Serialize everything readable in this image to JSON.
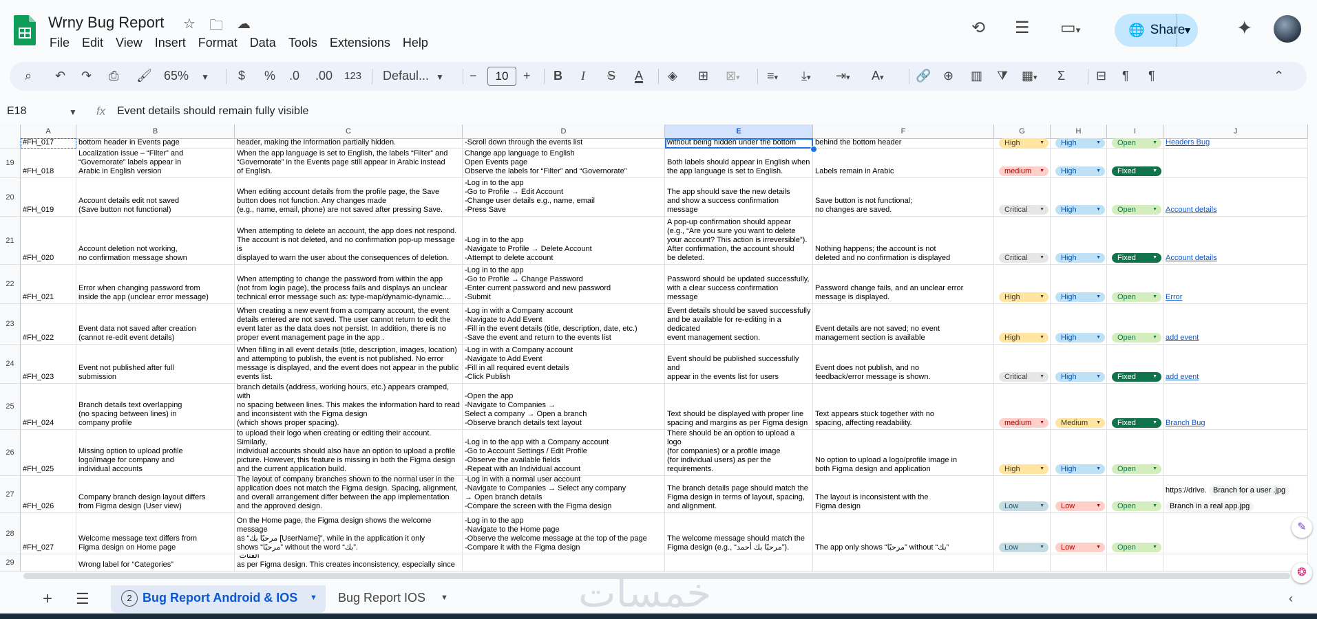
{
  "header": {
    "title": "Wrny Bug Report",
    "menu": [
      "File",
      "Edit",
      "View",
      "Insert",
      "Format",
      "Data",
      "Tools",
      "Extensions",
      "Help"
    ],
    "share_label": "Share",
    "colors": {
      "brand_green": "#0f9d58",
      "share_bg": "#c2e7ff"
    }
  },
  "toolbar": {
    "zoom": "65%",
    "currency": "$",
    "percent": "%",
    "dec_decrease": ".0",
    "dec_increase": ".00",
    "number_format": "123",
    "font": "Defaul...",
    "font_size": "10"
  },
  "formula": {
    "name_box": "E18",
    "fx": "fx",
    "content": "Event details should remain fully visible"
  },
  "columns": [
    "A",
    "B",
    "C",
    "D",
    "E",
    "F",
    "G",
    "H",
    "I",
    "J"
  ],
  "rows": [
    {
      "num": "",
      "id": "#FH_017",
      "title": "bottom header in Events page",
      "desc": "header, making the information partially hidden.",
      "steps": "-Scroll down through the events list",
      "expected": "without being hidden under the bottom head",
      "actual": "behind the bottom header",
      "severity": "High",
      "priority": "High",
      "status": "Open",
      "link": "Headers Bug",
      "extra": []
    },
    {
      "num": "19",
      "id": "#FH_018",
      "title": "Localization issue – “Filter” and\n“Governorate” labels appear in\n Arabic in English version",
      "desc": "When the app language is set to English, the labels “Filter” and\n“Governorate” in the Events page still appear in Arabic instead\nof English.",
      "steps": "Change app language to English\nOpen Events page\nObserve the labels for “Filter” and “Governorate”",
      "expected": "Both labels should appear in English when\n the app language is set to English.",
      "actual": "Labels remain in Arabic",
      "severity": "medium",
      "priority": "High",
      "status": "Fixed",
      "link": "",
      "extra": []
    },
    {
      "num": "20",
      "id": "#FH_019",
      "title": "Account details edit not saved\n (Save button not functional)",
      "desc": "When editing account details from the profile page, the Save\n button does not function. Any changes made\n(e.g., name, email, phone) are not saved after pressing Save.",
      "steps": "-Log in to the app\n-Go to Profile → Edit Account\n-Change user details e.g., name, email\n-Press Save",
      "expected": "The app should save the new details\n and show a success confirmation message",
      "actual": "Save button is not functional;\nno changes are saved.",
      "severity": "Critical",
      "priority": "High",
      "status": "Open",
      "link": "Account details",
      "extra": []
    },
    {
      "num": "21",
      "id": "#FH_020",
      "title": "Account deletion not working,\nno confirmation message shown",
      "desc": "When attempting to delete an account, the app does not respond.\nThe account is not deleted, and no confirmation pop-up message is\n displayed to warn the user about the consequences of deletion.",
      "steps": "-Log in to the app\n-Navigate to Profile → Delete Account\n-Attempt to delete account",
      "expected": "A pop-up confirmation should appear\n (e.g., “Are you sure you want to delete\nyour account? This action is irreversible”).\n After confirmation, the account should\nbe deleted.",
      "actual": "Nothing happens; the account is not\ndeleted and no confirmation is displayed",
      "severity": "Critical",
      "priority": "High",
      "status": "Fixed",
      "link": "Account details",
      "extra": []
    },
    {
      "num": "22",
      "id": "#FH_021",
      "title": "Error when changing password from\ninside the app (unclear error message)",
      "desc": "When attempting to change the password from within the app\n (not from login page), the process fails and displays an unclear\ntechnical error message such as: type-map/dynamic-dynamic....",
      "steps": "-Log in to the app\n-Go to Profile → Change Password\n-Enter current password and new password\n-Submit",
      "expected": "Password should be updated successfully,\nwith a clear success confirmation message",
      "actual": "Password change fails, and an unclear  error\n message is displayed.",
      "severity": "High",
      "priority": "High",
      "status": "Open",
      "link": "Error",
      "extra": []
    },
    {
      "num": "23",
      "id": "#FH_022",
      "title": "Event data not saved after creation\n(cannot re-edit event details)",
      "desc": "When creating a new event from a company account, the event\ndetails entered are not saved. The user cannot return to edit the\n event later as the data does not persist. In addition, there is no\nproper event management page in the app .",
      "steps": "-Log in with a Company account\n-Navigate to Add Event\n-Fill in the event details (title, description, date, etc.)\n-Save the event and return to the events list",
      "expected": "Event details should be saved successfully\nand be available for re-editing in a dedicated\nevent management section.",
      "actual": "Event details are not saved; no event\nmanagement section is available",
      "severity": "High",
      "priority": "High",
      "status": "Open",
      "link": "add event",
      "extra": []
    },
    {
      "num": "24",
      "id": "#FH_023",
      "title": "Event not published after full\nsubmission",
      "desc": "When filling in all event details (title, description, images, location)\nand attempting to publish, the event is not published. No error\n message is displayed, and the event does not appear in the public\nevents list.",
      "steps": "-Log in with a Company account\n-Navigate to Add Event\n-Fill in all required event details\n-Click Publish",
      "expected": "Event should be published successfully and\nappear in the events list for users",
      "actual": "Event does not publish, and no\n feedback/error message is shown.",
      "severity": "Critical",
      "priority": "High",
      "status": "Fixed",
      "link": "add event",
      "extra": []
    },
    {
      "num": "25",
      "id": "#FH_024",
      "title": "Branch details text overlapping\n(no spacing between lines) in\ncompany profile",
      "desc": "When viewing a company profile and opening a branch, the text in th\n branch details (address, working hours, etc.) appears cramped, with\nno spacing between lines. This makes the information hard to read\n and inconsistent with the Figma design\n(which shows proper spacing).",
      "steps": "-Open the app\n-Navigate to Companies →\n Select a company → Open a branch\n-Observe branch details text layout",
      "expected": "Text should be displayed with proper line\nspacing and margins as per Figma design",
      "actual": "Text appears stuck together with no\n spacing, affecting readability.",
      "severity": "medium",
      "priority": "Medium",
      "status": "Fixed",
      "link": "Branch Bug",
      "extra": []
    },
    {
      "num": "26",
      "id": "#FH_025",
      "title": "Missing option to upload profile\n logo/image for company and\n individual accounts",
      "desc": "According to the requirements document, companies should be able\n to upload their logo when creating or editing their account. Similarly,\nindividual accounts should also have an option to upload a profile\n picture. However, this feature is missing in both the Figma design\nand the current application build.",
      "steps": "-Log in to the app with a Company account\n-Go to Account Settings / Edit Profile\n-Observe the available fields\n-Repeat with an Individual account",
      "expected": "There should be an option to upload a logo\n(for companies) or a profile image\n (for individual users) as per the\n requirements.",
      "actual": "No option to upload a logo/profile image in\n both Figma design and application",
      "severity": "High",
      "priority": "High",
      "status": "Open",
      "link": "",
      "extra": []
    },
    {
      "num": "27",
      "id": "#FH_026",
      "title": "Company branch design layout differs\n from Figma design (User view)",
      "desc": "The layout of company branches shown to the normal user in the\napplication does not match the Figma design. Spacing, alignment,\nand overall arrangement differ between the app implementation\nand the approved design.",
      "steps": "-Log in with a normal user account\n-Navigate to Companies → Select any company\n→ Open branch details\n-Compare the screen with the Figma design",
      "expected": "The branch details page should match the\nFigma design in terms of layout, spacing,\nand alignment.",
      "actual": "The layout is inconsistent with the\nFigma design",
      "severity": "Low",
      "priority": "Low",
      "status": "Open",
      "link": "",
      "extra": [
        "https://drive.",
        "Branch for a user .jpg",
        "Branch in a real app.jpg"
      ]
    },
    {
      "num": "28",
      "id": "#FH_027",
      "title": "Welcome message text differs from\nFigma design on Home page",
      "desc": "On the Home page, the Figma design shows the welcome message\n as “مرحبًا بك [UserName]”, while in the application it only\n shows “مرحبًا” without the word “بك”.",
      "steps": "-Log in to the app\n-Navigate to the Home page\n-Observe the welcome message at the top of the page\n-Compare it with the Figma design",
      "expected": "The welcome message should match the\n Figma design (e.g., “مرحبًا بك أحمد”).",
      "actual": "The app only shows “مرحبًا” without “بك”",
      "severity": "Low",
      "priority": "Low",
      "status": "Open",
      "link": "",
      "extra": []
    },
    {
      "num": "29",
      "id": "",
      "title": "Wrong label for “Categories”",
      "desc": "In the Home page, the section is labeled “الأقسام” instead of “الفئات”\nas per Figma design. This creates inconsistency, especially since",
      "steps": "",
      "expected": "",
      "actual": "",
      "severity": "",
      "priority": "",
      "status": "",
      "link": "",
      "extra": []
    }
  ],
  "chip_colors": {
    "High": {
      "bg": "#ffe5a0",
      "fg": "#473821"
    },
    "medium": {
      "bg": "#ffcfc9",
      "fg": "#b10202"
    },
    "Medium": {
      "bg": "#ffe5a0",
      "fg": "#473821"
    },
    "Critical": {
      "bg": "#e6e6e6",
      "fg": "#3d3d3d"
    },
    "Low": {
      "bg": "#c6dbe1",
      "fg": "#215a6c"
    },
    "Open": {
      "bg": "#d4edbc",
      "fg": "#11734b"
    },
    "Fixed": {
      "bg": "#11734b",
      "fg": "#ffffff"
    },
    "priority_High": {
      "bg": "#bfe1f6",
      "fg": "#0a53a8"
    },
    "priority_Medium": {
      "bg": "#ffe5a0",
      "fg": "#473821"
    },
    "priority_Low": {
      "bg": "#ffcfc9",
      "fg": "#b10202"
    }
  },
  "sheets": {
    "count_badge": "2",
    "active": "Bug Report Android & IOS",
    "other": "Bug Report IOS"
  },
  "watermark": "خمسات"
}
